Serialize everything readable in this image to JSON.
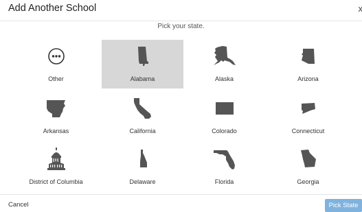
{
  "dialog": {
    "title": "Add Another School",
    "close_glyph": "x",
    "subtitle": "Pick your state.",
    "selected_state": "Alabama"
  },
  "states": [
    {
      "label": "Other",
      "icon": "more-icon"
    },
    {
      "label": "Alabama",
      "icon": "alabama-shape-icon"
    },
    {
      "label": "Alaska",
      "icon": "alaska-shape-icon"
    },
    {
      "label": "Arizona",
      "icon": "arizona-shape-icon"
    },
    {
      "label": "Arkansas",
      "icon": "arkansas-shape-icon"
    },
    {
      "label": "California",
      "icon": "california-shape-icon"
    },
    {
      "label": "Colorado",
      "icon": "colorado-shape-icon"
    },
    {
      "label": "Connecticut",
      "icon": "connecticut-shape-icon"
    },
    {
      "label": "District of Columbia",
      "icon": "capitol-building-icon"
    },
    {
      "label": "Delaware",
      "icon": "delaware-shape-icon"
    },
    {
      "label": "Florida",
      "icon": "florida-shape-icon"
    },
    {
      "label": "Georgia",
      "icon": "georgia-shape-icon"
    }
  ],
  "footer": {
    "cancel_label": "Cancel",
    "pick_label": "Pick State"
  },
  "colors": {
    "selected_bg": "#d7d7d7",
    "shape_fill": "#555555",
    "primary_button": "#7fb3dd"
  }
}
